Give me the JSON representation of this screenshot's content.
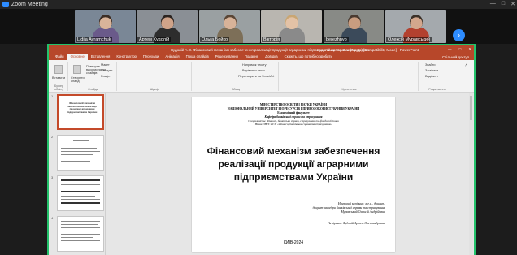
{
  "zoom": {
    "title": "Zoom Meeting",
    "min": "—",
    "max": "□",
    "close": "✕"
  },
  "participants": [
    {
      "name": "Lidiia Avramchuk",
      "bg": "#7a8796",
      "hair": "#3c2e26",
      "skin": "#d9b49a",
      "shirt": "#6a5a8a"
    },
    {
      "name": "Артем Худолій",
      "bg": "#8a8f95",
      "hair": "#2b2421",
      "skin": "#cfa389",
      "shirt": "#2d2d2d"
    },
    {
      "name": "Ольга Бойко",
      "bg": "#9aa0a2",
      "hair": "#5a4636",
      "skin": "#d8b399",
      "shirt": "#7d6f58"
    },
    {
      "name": "Вікторія",
      "bg": "#b9b6b0",
      "hair": "#c9a673",
      "skin": "#e3c2a6",
      "shirt": "#8a8a8a"
    },
    {
      "name": "berezhnyo",
      "bg": "#888a86",
      "hair": "#4a3a30",
      "skin": "#c99d80",
      "shirt": "#3b4a5a"
    },
    {
      "name": "Олексій Муравський",
      "bg": "#a4a9ad",
      "hair": "#3a3129",
      "skin": "#d3a78d",
      "shirt": "#b3412f"
    }
  ],
  "next_icon": "chevron-right",
  "ppt": {
    "title": "Худолій А.О. Фінансовий механізм забезпечення реалізації продукції аграрними підприємствами України (8.pptx) [Compatibility Mode] - PowerPoint",
    "user": "Худолій Артем Олександрович",
    "tabs": [
      "Файл",
      "Основне",
      "Вставлення",
      "Конструктор",
      "Переходи",
      "Анімація",
      "Показ слайдів",
      "Рецензування",
      "Подання",
      "Довідка",
      "Скажіть, що потрібно зробити"
    ],
    "share": "Спільний доступ",
    "ribbon": {
      "paste": "Вставити",
      "clipboard": "Буфер обміну",
      "new_slide": "Створити слайд",
      "reuse": "Повторне використання слайдів",
      "layout": "Макет",
      "reset": "Скинути",
      "section": "Розділ",
      "slides": "Слайди",
      "font": "Шрифт",
      "paragraph": "Абзац",
      "text_dir": "Напрямок тексту",
      "align_text": "Вирівняти текст",
      "smartart": "Перетворити на SmartArt",
      "drawing": "Креслення",
      "find": "Знайти",
      "replace": "Замінити",
      "select": "Виділити",
      "editing": "Редагування"
    },
    "thumb_numbers": [
      "1",
      "2",
      "3",
      "4"
    ],
    "thumb1_text": "Фінансовий механізм забезпечення реалізації продукції аграрними підприємствами України"
  },
  "slide": {
    "ministry": "МІНІСТЕРСТВО ОСВІТИ І НАУКИ УКРАЇНИ",
    "university": "НАЦІОНАЛЬНИЙ УНІВЕРСИТЕТ БІОРЕСУРСІВ І ПРИРОДОКОРИСТУВАННЯ УКРАЇНИ",
    "faculty": "Економічний факультет",
    "department": "Кафедра банківської справи та страхування",
    "spec1": "Спеціальність: Фінанси, банківська справа, страхування та фондовий ринок",
    "spec2": "Назва ОНП: ФСП «Фінанси, банківська справа та страхування»",
    "title": "Фінансовий механізм забезпечення реалізації продукції аграрними підприємствами України",
    "sup1": "Науковий керівник: к.е.н., доцент,",
    "sup2": "доцент кафедри банківської справи та страхування",
    "sup3": "Муравський Олексій Андрійович",
    "aspirant": "Аспірант: Худолій Артем Олександрович",
    "city": "КИЇВ-2024"
  }
}
